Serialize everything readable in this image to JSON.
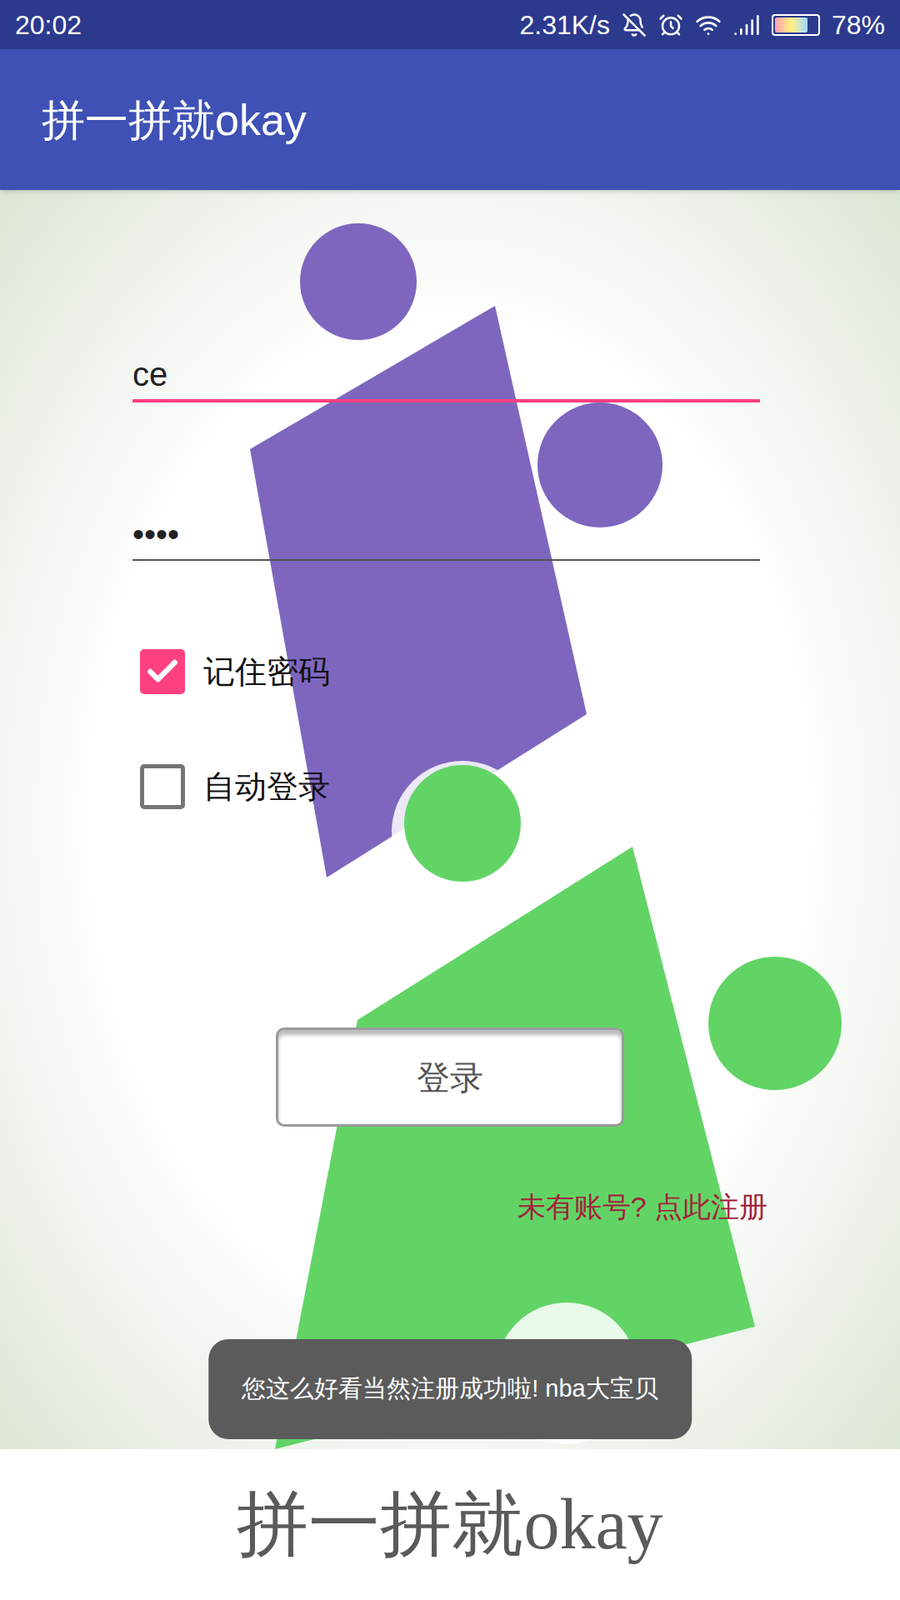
{
  "status_bar": {
    "time": "20:02",
    "speed": "2.31K/s",
    "battery": "78%",
    "battery_level": 0.78
  },
  "app_bar": {
    "title": "拼一拼就okay"
  },
  "login_form": {
    "username": "ce",
    "username_focused": true,
    "password": "••••",
    "checkboxes": [
      {
        "label": "记住密码",
        "checked": true
      },
      {
        "label": "自动登录",
        "checked": false
      }
    ],
    "login_button": "登录",
    "register_link": "未有账号? 点此注册"
  },
  "toast": "您这么好看当然注册成功啦! nba大宝贝",
  "footer_logo": "拼一拼就okay"
}
